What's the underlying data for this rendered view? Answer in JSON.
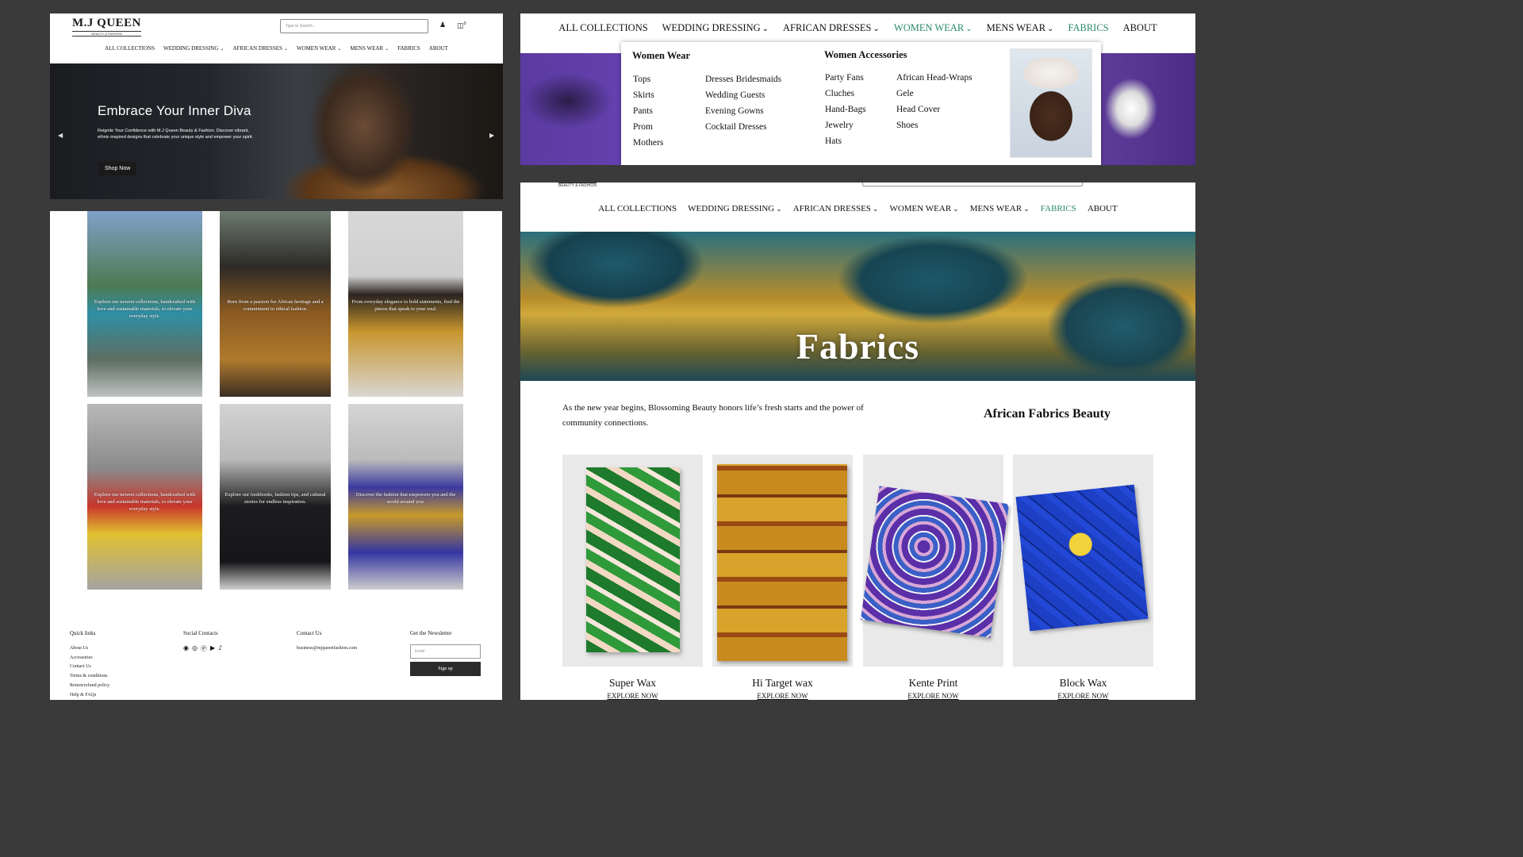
{
  "home": {
    "logo": {
      "name": "M.J QUEEN",
      "tagline": "BEAUTY & FASHION"
    },
    "search_placeholder": "Type to Search...",
    "cart_count": "0",
    "nav": [
      "ALL COLLECTIONS",
      "WEDDING DRESSING",
      "AFRICAN DRESSES",
      "WOMEN WEAR",
      "MENS WEAR",
      "FABRICS",
      "ABOUT"
    ],
    "hero": {
      "title": "Embrace Your Inner Diva",
      "subtitle": "Reignite Your Confidence with M.J Queen Beauty & Fashion. Discover vibrant, ethnic-inspired designs that celebrate your unique style and empower your spirit.",
      "button": "Shop Now"
    }
  },
  "gallery": {
    "tiles": [
      "Explore our newest collections, handcrafted with love and sustainable materials, to elevate your everyday style.",
      "Born from a passion for African heritage and a commitment to ethical fashion.",
      "From everyday elegance to bold statements, find the pieces that speak to your soul.",
      "Explore our newest collections, handcrafted with love and sustainable materials, to elevate your everyday style.",
      "Explore our lookbooks, fashion tips, and cultural stories for endless inspiration.",
      "Discover the fashion that empowers you and the world around you."
    ]
  },
  "footer": {
    "quick_links_title": "Quick links",
    "quick_links": [
      "About Us",
      "Accessories",
      "Contact Us",
      "Terms & conditions",
      "Return/refund policy",
      "Help & FAQs"
    ],
    "social_title": "Social Contacts",
    "social_icons": [
      "facebook-icon",
      "instagram-icon",
      "pinterest-icon",
      "youtube-icon",
      "tiktok-icon"
    ],
    "contact_title": "Contact Us",
    "contact_email": "business@mjqueenfashion.com",
    "newsletter_title": "Get the Newsletter",
    "newsletter_placeholder": "Email",
    "newsletter_button": "Sign up"
  },
  "megamenu": {
    "nav": [
      "ALL COLLECTIONS",
      "WEDDING DRESSING",
      "AFRICAN DRESSES",
      "WOMEN WEAR",
      "MENS WEAR",
      "FABRICS",
      "ABOUT"
    ],
    "active_color": "#2a8a6c",
    "women_wear_title": "Women Wear",
    "women_wear_col1": [
      "Tops",
      "Skirts",
      "Pants",
      "Prom",
      "Mothers"
    ],
    "women_wear_col2": [
      "Dresses Bridesmaids",
      "Wedding Guests",
      "Evening Gowns",
      "Cocktail Dresses"
    ],
    "accessories_title": "Women Accessories",
    "accessories_col1": [
      "Party Fans",
      "Cluches",
      "Hand-Bags",
      "Jewelry",
      "Hats"
    ],
    "accessories_col2": [
      "African Head-Wraps",
      "Gele",
      "Head Cover",
      "Shoes"
    ]
  },
  "fabrics_page": {
    "tagline": "BEAUTY & FASHION",
    "nav": [
      "ALL COLLECTIONS",
      "WEDDING DRESSING",
      "AFRICAN DRESSES",
      "WOMEN WEAR",
      "MENS WEAR",
      "FABRICS",
      "ABOUT"
    ],
    "banner_title": "Fabrics",
    "intro": "As the new year begins, Blossoming Beauty honors life’s fresh starts and the power of community connections.",
    "section_heading": "African Fabrics Beauty",
    "products": [
      {
        "name": "Super Wax",
        "cta": "EXPLORE NOW"
      },
      {
        "name": "Hi Target wax",
        "cta": "EXPLORE NOW"
      },
      {
        "name": "Kente Print",
        "cta": "EXPLORE NOW"
      },
      {
        "name": "Block Wax",
        "cta": "EXPLORE NOW"
      }
    ]
  }
}
